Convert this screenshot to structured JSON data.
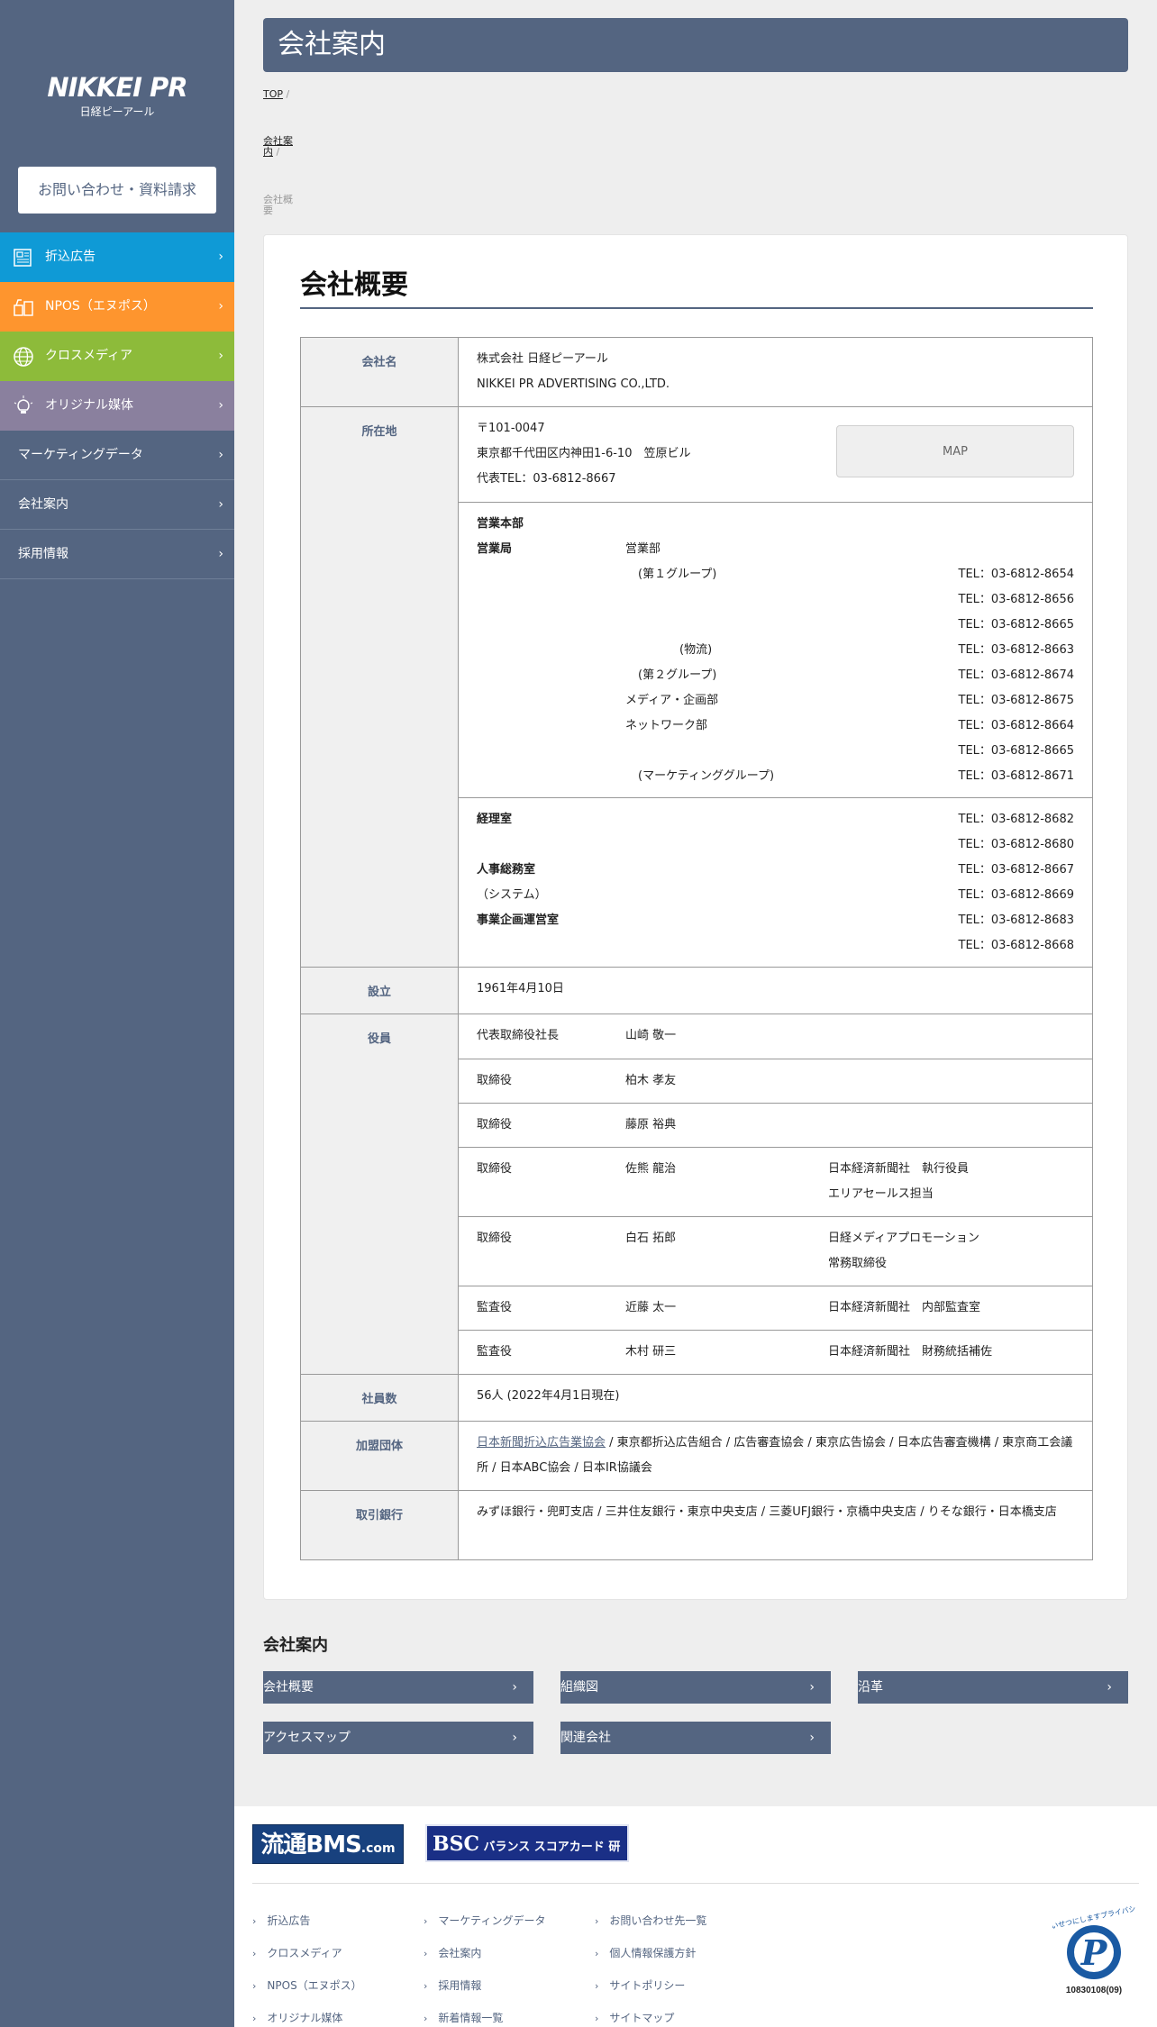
{
  "sidebar": {
    "logo": "NIKKEI PR",
    "logo_sub": "日経ピーアール",
    "contact_button": "お問い合わせ・資料請求",
    "items": [
      {
        "label": "折込広告"
      },
      {
        "label": "NPOS（エヌポス）"
      },
      {
        "label": "クロスメディア"
      },
      {
        "label": "オリジナル媒体"
      },
      {
        "label": "マーケティングデータ"
      },
      {
        "label": "会社案内"
      },
      {
        "label": "採用情報"
      }
    ],
    "colors": {
      "sidebar": "#546581",
      "orikomi": "#0f9ad6",
      "npos": "#fe952e",
      "cross": "#8dbb3a",
      "original": "#8a809e"
    }
  },
  "header": {
    "title": "会社案内"
  },
  "breadcrumb": [
    {
      "line1": "TOP",
      "line2": ""
    },
    {
      "line1": "会社案",
      "line2": "内"
    },
    {
      "line1": "会社概",
      "line2": "要"
    }
  ],
  "overview": {
    "heading": "会社概要",
    "company_name": {
      "label": "会社名",
      "ja": "株式会社 日経ピーアール",
      "en": "NIKKEI PR ADVERTISING CO.,LTD."
    },
    "address": {
      "label": "所在地",
      "zip": "〒101-0047",
      "addr": "東京都千代田区内神田1-6-10　笠原ビル",
      "tel": "代表TEL：03-6812-8667",
      "map": "MAP"
    },
    "sales": {
      "hq": "営業本部",
      "bureau": "営業局",
      "dept": "営業部",
      "rows": [
        {
          "name": "(第１グループ)",
          "tel": "TEL：03-6812-8654"
        },
        {
          "name": "",
          "tel": "TEL：03-6812-8656"
        },
        {
          "name": "",
          "tel": "TEL：03-6812-8665"
        },
        {
          "name": "(物流)",
          "tel": "TEL：03-6812-8663"
        },
        {
          "name": "(第２グループ)",
          "tel": "TEL：03-6812-8674"
        },
        {
          "name": "メディア・企画部",
          "tel": "TEL：03-6812-8675"
        },
        {
          "name": "ネットワーク部",
          "tel": "TEL：03-6812-8664"
        },
        {
          "name": "",
          "tel": "TEL：03-6812-8665"
        },
        {
          "name": "(マーケティンググループ)",
          "tel": "TEL：03-6812-8671"
        }
      ]
    },
    "offices": [
      {
        "name": "経理室",
        "bold": true,
        "tel": "TEL：03-6812-8682"
      },
      {
        "name": "",
        "bold": false,
        "tel": "TEL：03-6812-8680"
      },
      {
        "name": "人事総務室",
        "bold": true,
        "tel": "TEL：03-6812-8667"
      },
      {
        "name": "（システム）",
        "bold": false,
        "tel": "TEL：03-6812-8669"
      },
      {
        "name": "事業企画運営室",
        "bold": true,
        "tel": "TEL：03-6812-8683"
      },
      {
        "name": "",
        "bold": false,
        "tel": "TEL：03-6812-8668"
      }
    ],
    "founded": {
      "label": "設立",
      "value": "1961年4月10日"
    },
    "officers": {
      "label": "役員",
      "rows": [
        {
          "title": "代表取締役社長",
          "name": "山崎 敬一",
          "note1": "",
          "note2": ""
        },
        {
          "title": "取締役",
          "name": "柏木 孝友",
          "note1": "",
          "note2": ""
        },
        {
          "title": "取締役",
          "name": "藤原 裕典",
          "note1": "",
          "note2": ""
        },
        {
          "title": "取締役",
          "name": "佐熊 龍治",
          "note1": "日本経済新聞社　執行役員",
          "note2": "エリアセールス担当"
        },
        {
          "title": "取締役",
          "name": "白石 拓郎",
          "note1": "日経メディアプロモーション",
          "note2": "常務取締役"
        },
        {
          "title": "監査役",
          "name": "近藤 太一",
          "note1": "日本経済新聞社　内部監査室",
          "note2": ""
        },
        {
          "title": "監査役",
          "name": "木村 研三",
          "note1": "日本経済新聞社　財務統括補佐",
          "note2": ""
        }
      ]
    },
    "employees": {
      "label": "社員数",
      "value": "56人 (2022年4月1日現在)"
    },
    "associations": {
      "label": "加盟団体",
      "link": "日本新聞折込広告業協会",
      "rest": " / 東京都折込広告組合 / 広告審査協会 / 東京広告協会 / 日本広告審査機構 / 東京商工会議所 / 日本ABC協会 / 日本IR協議会"
    },
    "banks": {
      "label": "取引銀行",
      "value": "みずほ銀行・兜町支店 / 三井住友銀行・東京中央支店 / 三菱UFJ銀行・京橋中央支店 / りそな銀行・日本橋支店"
    }
  },
  "section": {
    "title": "会社案内",
    "buttons": [
      "会社概要",
      "組織図",
      "沿革",
      "アクセスマップ",
      "関連会社"
    ]
  },
  "footer": {
    "banner1": "流通BMS",
    "banner1_sub": ".com",
    "banner2_big": "BSC",
    "banner2": "バランス スコアカード 研究会",
    "links_col1": [
      "折込広告",
      "クロスメディア",
      "NPOS（エヌポス）",
      "オリジナル媒体"
    ],
    "links_col2": [
      "マーケティングデータ",
      "会社案内",
      "採用情報",
      "新着情報一覧"
    ],
    "links_col3": [
      "お問い合わせ先一覧",
      "個人情報保護方針",
      "サイトポリシー",
      "サイトマップ"
    ],
    "privacy_text": "たいせつにしますプライバシー",
    "privacy_id": "10830108(09)"
  }
}
